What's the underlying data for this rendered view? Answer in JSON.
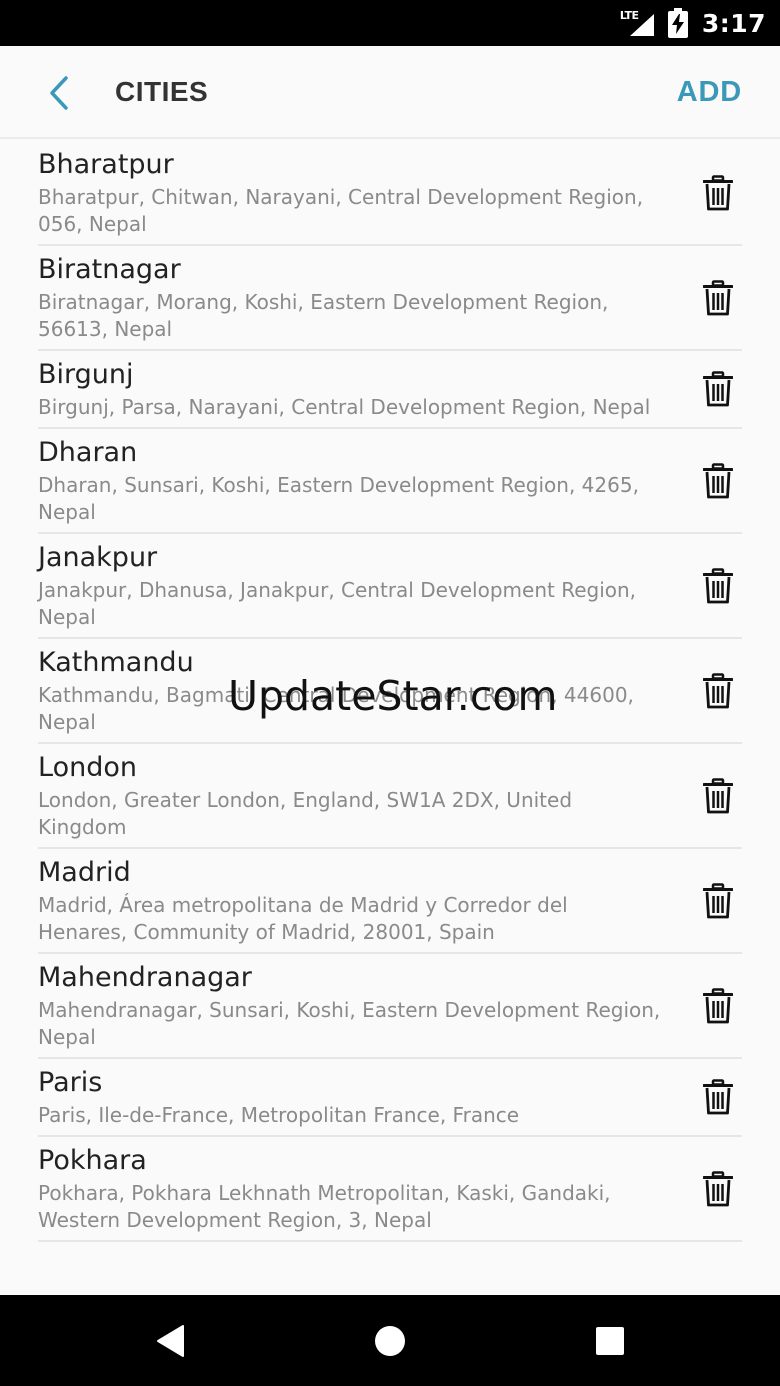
{
  "status_bar": {
    "network_label": "LTE",
    "time": "3:17",
    "icons": [
      "signal-icon",
      "battery-charging-icon"
    ]
  },
  "app_bar": {
    "title": "CITIES",
    "action_label": "ADD",
    "back_icon": "chevron-left-icon",
    "accent_color": "#3a98b8"
  },
  "cities": [
    {
      "name": "Bharatpur",
      "address": "Bharatpur, Chitwan, Narayani, Central Development Region, 056, Nepal"
    },
    {
      "name": "Biratnagar",
      "address": "Biratnagar, Morang, Koshi, Eastern Development Region, 56613, Nepal"
    },
    {
      "name": "Birgunj",
      "address": "Birgunj, Parsa, Narayani, Central Development Region, Nepal"
    },
    {
      "name": "Dharan",
      "address": "Dharan, Sunsari, Koshi, Eastern Development Region, 4265, Nepal"
    },
    {
      "name": "Janakpur",
      "address": "Janakpur, Dhanusa, Janakpur, Central Development Region, Nepal"
    },
    {
      "name": "Kathmandu",
      "address": "Kathmandu, Bagmati, Central Development Region, 44600, Nepal"
    },
    {
      "name": "London",
      "address": "London, Greater London, England, SW1A 2DX, United Kingdom"
    },
    {
      "name": "Madrid",
      "address": "Madrid, Área metropolitana de Madrid y Corredor del Henares, Community of Madrid, 28001, Spain"
    },
    {
      "name": "Mahendranagar",
      "address": "Mahendranagar, Sunsari, Koshi, Eastern Development Region, Nepal"
    },
    {
      "name": "Paris",
      "address": "Paris, Ile-de-France, Metropolitan France, France"
    },
    {
      "name": "Pokhara",
      "address": "Pokhara, Pokhara Lekhnath Metropolitan, Kaski, Gandaki, Western Development Region, 3, Nepal"
    }
  ],
  "row_icon": "trash-icon",
  "watermark": "UpdateStar.com",
  "nav_bar": {
    "icons": [
      "back-triangle-icon",
      "home-circle-icon",
      "recents-square-icon"
    ]
  }
}
